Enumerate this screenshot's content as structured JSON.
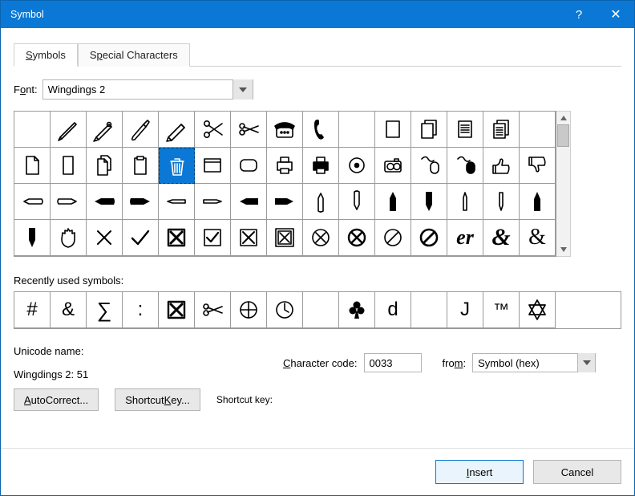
{
  "title": "Symbol",
  "tabs": {
    "symbols": "Symbols",
    "special": "Special Characters"
  },
  "font": {
    "label_pre": "F",
    "label_ul": "o",
    "label_post": "nt:",
    "value": "Wingdings 2"
  },
  "recent_label_pre": "R",
  "recent_label_ul": "e",
  "recent_label_post": "cently used symbols:",
  "recent": [
    "#",
    "&",
    "∑",
    ":",
    "⊠",
    "✂",
    "⊕",
    "🕐",
    "",
    "♣",
    "d",
    "",
    "J",
    "™",
    "✡"
  ],
  "unicode_name_label": "Unicode name:",
  "unicode_name_value": "Wingdings 2: 51",
  "charcode": {
    "label_ul": "C",
    "label_post": "haracter code:",
    "value": "0033"
  },
  "from": {
    "label_pre": "fro",
    "label_ul": "m",
    "label_post": ":",
    "value": "Symbol (hex)"
  },
  "buttons": {
    "autocorrect_ul": "A",
    "autocorrect_post": "utoCorrect...",
    "shortcut_pre": "Shortcut ",
    "shortcut_ul": "K",
    "shortcut_post": "ey...",
    "shortcut_label": "Shortcut key:",
    "insert_ul": "I",
    "insert_post": "nsert",
    "cancel": "Cancel"
  },
  "grid": [
    [
      "blank",
      "pen",
      "fountain-pen",
      "brush",
      "pencil",
      "scissors-open",
      "scissors",
      "telephone",
      "handset",
      "",
      "page-outline",
      "pages-outline",
      "page-lines",
      "pages-lines"
    ],
    [
      "page",
      "page-thin",
      "pages",
      "clipboard",
      "trash",
      "window",
      "rounded-rect",
      "printer",
      "printer-fill",
      "disc",
      "camera",
      "mouse-cable",
      "mouse-cable-fill",
      "thumb-up",
      "thumb-down"
    ],
    [
      "hand-left-outline",
      "hand-right-outline",
      "hand-left-fill",
      "hand-right-fill",
      "hand-left-thin",
      "hand-right-thin",
      "hand-left-fill2",
      "hand-right-fill2",
      "hand-up-outline",
      "hand-down-outline",
      "hand-up-fill",
      "hand-down-fill",
      "hand-up-thin",
      "hand-down-thin",
      "hand-up-point"
    ],
    [
      "hand-down-point",
      "hand-spread",
      "x-thin",
      "check",
      "x-box-bold",
      "check-box",
      "x-box",
      "x-box-outline",
      "circled-x",
      "circled-x-bold",
      "prohibit",
      "prohibit-bold",
      "er-script",
      "amp-bold-italic",
      "amp-serif"
    ]
  ]
}
